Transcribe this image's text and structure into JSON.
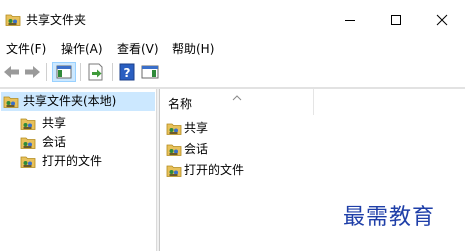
{
  "window": {
    "title": "共享文件夹",
    "icon": "shared-folder-icon",
    "controls": [
      "minimize-icon",
      "maximize-icon",
      "close-icon"
    ]
  },
  "menu": [
    {
      "label": "文件(F)"
    },
    {
      "label": "操作(A)"
    },
    {
      "label": "查看(V)"
    },
    {
      "label": "帮助(H)"
    }
  ],
  "toolbar": {
    "icons": [
      "back-arrow-icon",
      "forward-arrow-icon",
      "show-hide-tree-icon",
      "export-list-icon",
      "help-icon",
      "show-action-pane-icon"
    ]
  },
  "tree": {
    "root": {
      "label": "共享文件夹(本地)",
      "icon": "shared-folder-icon"
    },
    "children": [
      {
        "label": "共享",
        "icon": "shared-folder-icon"
      },
      {
        "label": "会话",
        "icon": "shared-folder-icon"
      },
      {
        "label": "打开的文件",
        "icon": "shared-folder-icon"
      }
    ]
  },
  "list": {
    "column_header": "名称",
    "items": [
      {
        "label": "共享",
        "icon": "shared-folder-icon"
      },
      {
        "label": "会话",
        "icon": "shared-folder-icon"
      },
      {
        "label": "打开的文件",
        "icon": "shared-folder-icon"
      }
    ]
  },
  "watermark": "最需教育",
  "colors": {
    "selection": "#cce8ff",
    "folder": "#e8c15a",
    "help_blue": "#2a5fc1",
    "watermark": "#1f3fa8"
  }
}
